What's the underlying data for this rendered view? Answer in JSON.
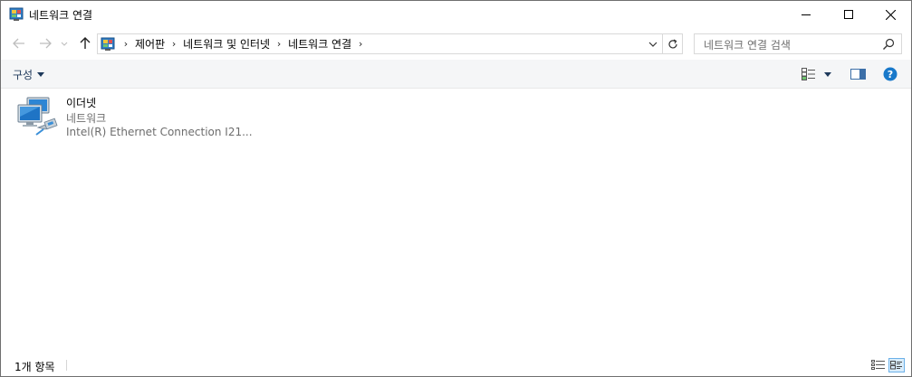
{
  "window": {
    "title": "네트워크 연결"
  },
  "navigation": {
    "breadcrumbs": [
      "제어판",
      "네트워크 및 인터넷",
      "네트워크 연결"
    ],
    "search_placeholder": "네트워크 연결 검색"
  },
  "command_bar": {
    "organize_label": "구성"
  },
  "content": {
    "items": [
      {
        "name": "이더넷",
        "status": "네트워크",
        "device": "Intel(R) Ethernet Connection I21..."
      }
    ]
  },
  "status_bar": {
    "item_count": "1개 항목"
  },
  "colors": {
    "accent": "#1979ca",
    "command_bar_bg": "#f5f6f7",
    "organize_text": "#1e395b"
  },
  "icons": {
    "app": "network-connections-icon",
    "back": "arrow-left-icon",
    "forward": "arrow-right-icon",
    "up": "arrow-up-icon",
    "refresh": "refresh-icon",
    "search": "search-icon",
    "help": "help-icon",
    "ethernet": "ethernet-adapter-icon"
  }
}
